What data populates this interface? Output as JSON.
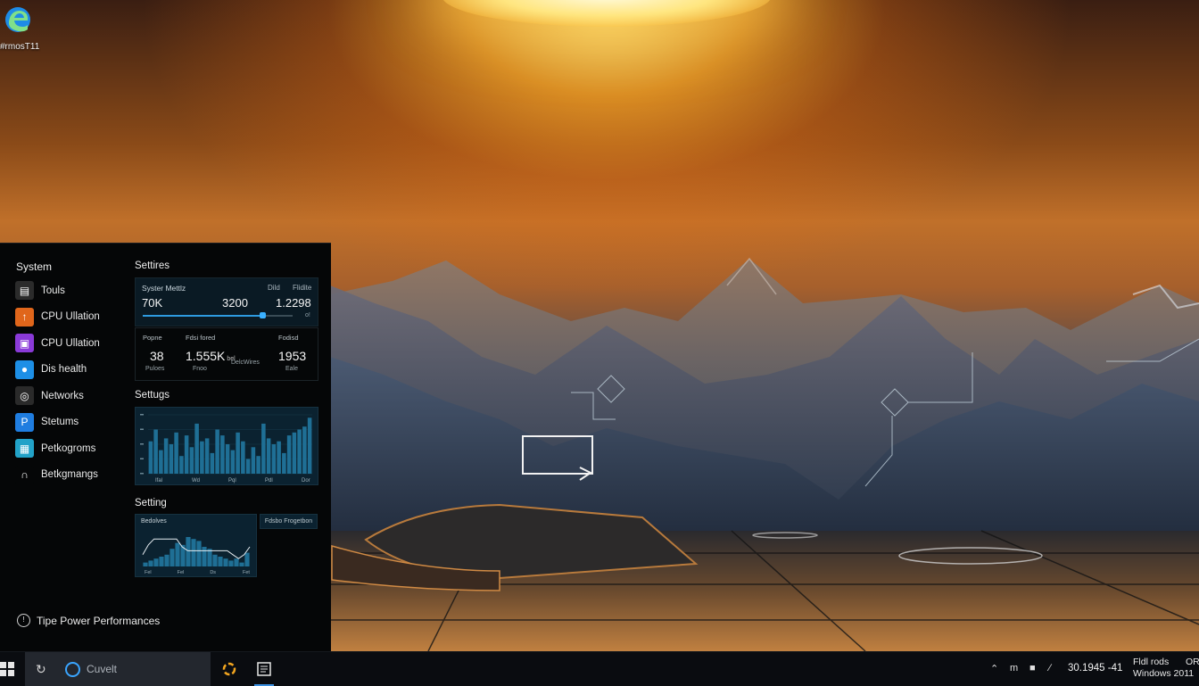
{
  "desktop": {
    "icon_label": "#rmosT11"
  },
  "side_panel": {
    "nav_heading": "System",
    "nav_items": [
      {
        "label": "Touls",
        "icon": "toolbox-icon",
        "color": "#2b2b2b"
      },
      {
        "label": "CPU Ullation",
        "icon": "cpu-icon",
        "color": "#e0661b"
      },
      {
        "label": "CPU Ullation",
        "icon": "chip-icon",
        "color": "#8a3ad8"
      },
      {
        "label": "Dis health",
        "icon": "disk-health-icon",
        "color": "#1d8fe6"
      },
      {
        "label": "Networks",
        "icon": "chrome-network-icon",
        "color": "#2a2a2a"
      },
      {
        "label": "Stetums",
        "icon": "status-icon",
        "color": "#1f7de0"
      },
      {
        "label": "Petkogroms",
        "icon": "programs-icon",
        "color": "#22a2c8"
      },
      {
        "label": "Betkgmangs",
        "icon": "headphones-icon",
        "color": "#050607"
      }
    ],
    "col_heading_1": "Settires",
    "metrics": {
      "title": "Syster Mettlz",
      "col1": "Dild",
      "col2": "Flidite",
      "value1": "70K",
      "value2": "3200",
      "value3": "1.2298",
      "slider_end": "o!",
      "slider_level": 0.8
    },
    "stats": [
      {
        "label": "Popne",
        "value": "38",
        "unit": "",
        "sub": "Puloes"
      },
      {
        "label": "Fdsi fored",
        "value": "1.555K",
        "unit": "bel",
        "sub": "Fnoo"
      },
      {
        "label": "",
        "value": "",
        "unit": "",
        "sub": "DelcWires"
      },
      {
        "label": "Fodisd",
        "value": "1953",
        "unit": "",
        "sub": "Eale"
      }
    ],
    "col_heading_2": "Settugs",
    "col_heading_3": "Setting",
    "line_card_title": "Bedolves",
    "legend_chip": "Fdsbo Frogetbon",
    "footer_link": "Tipe Power Performances"
  },
  "chart_data": [
    {
      "type": "bar",
      "title": "",
      "categories": [
        "1",
        "2",
        "3",
        "4",
        "5",
        "6",
        "7",
        "8",
        "9",
        "10",
        "11",
        "12",
        "13",
        "14",
        "15",
        "16",
        "17",
        "18",
        "19",
        "20",
        "21",
        "22",
        "23",
        "24",
        "25",
        "26",
        "27",
        "28",
        "29",
        "30",
        "31",
        "32"
      ],
      "values": [
        55,
        75,
        40,
        60,
        50,
        70,
        30,
        65,
        45,
        85,
        55,
        60,
        35,
        75,
        65,
        50,
        40,
        70,
        55,
        25,
        45,
        30,
        85,
        60,
        50,
        55,
        35,
        65,
        70,
        75,
        80,
        95
      ],
      "tick_labels": [
        "Ifal",
        "Wd",
        "Pql",
        "Pdl",
        "Dor"
      ],
      "ylim": [
        0,
        100
      ],
      "color": "#1f6f95"
    },
    {
      "type": "area",
      "title": "",
      "x": [
        1,
        2,
        3,
        4,
        5,
        6,
        7,
        8,
        9,
        10,
        11,
        12,
        13,
        14,
        15,
        16,
        17,
        18,
        19,
        20
      ],
      "values": [
        10,
        15,
        20,
        25,
        30,
        45,
        60,
        55,
        75,
        70,
        65,
        50,
        45,
        30,
        25,
        20,
        15,
        20,
        10,
        35
      ],
      "line_values": [
        30,
        55,
        70,
        70,
        70,
        70,
        70,
        50,
        40,
        40,
        40,
        40,
        40,
        40,
        40,
        40,
        30,
        20,
        30,
        50
      ],
      "tick_labels": [
        "Fel",
        "Fel",
        "Ds",
        "Fet"
      ],
      "ylim": [
        0,
        100
      ],
      "color": "#1f6f95"
    }
  ],
  "taskbar": {
    "search_text": "Cuvelt",
    "tray_lang": "m",
    "time": "30.1945 -41",
    "info_line1": "Fldl rods",
    "info_line2": "Windows 2011",
    "info_right": "OR"
  }
}
